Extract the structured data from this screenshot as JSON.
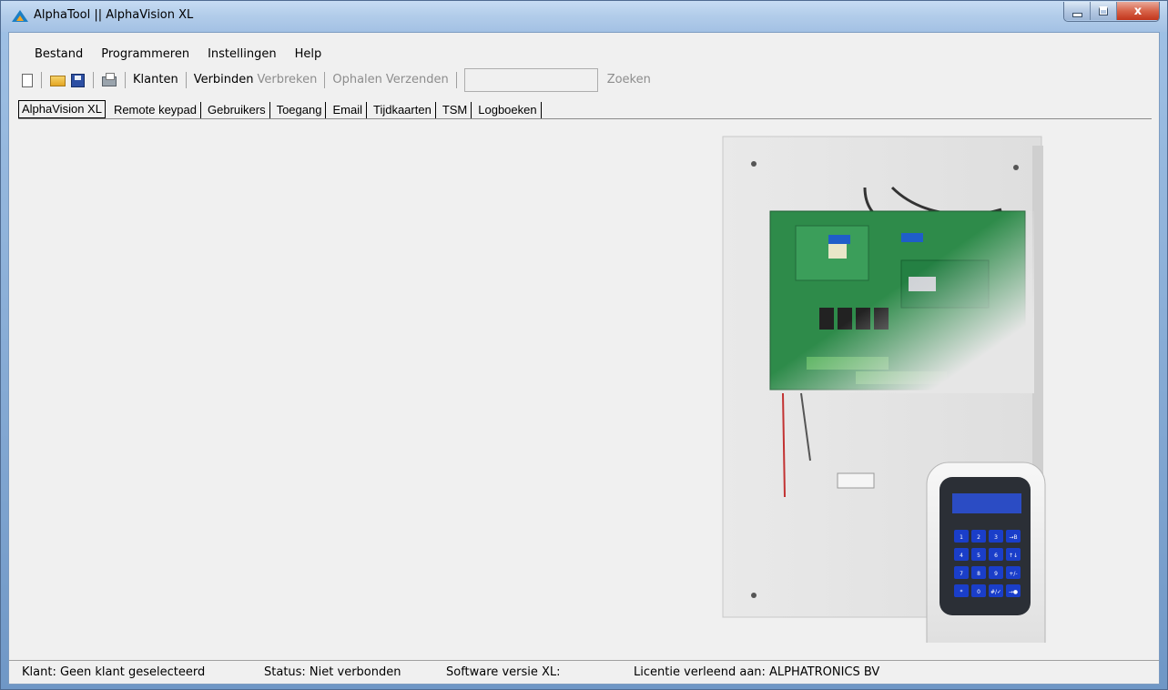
{
  "window": {
    "title": "AlphaTool || AlphaVision XL",
    "min_label": "",
    "max_label": "",
    "close_label": "x"
  },
  "menu": [
    "Bestand",
    "Programmeren",
    "Instellingen",
    "Help"
  ],
  "toolbar": {
    "klanten": "Klanten",
    "verbinden": "Verbinden",
    "verbreken": "Verbreken",
    "ophalen": "Ophalen",
    "verzenden": "Verzenden",
    "search_value": "",
    "zoeken": "Zoeken"
  },
  "tabs": [
    "AlphaVision XL",
    "Remote keypad",
    "Gebruikers",
    "Toegang",
    "Email",
    "Tijdkaarten",
    "TSM",
    "Logboeken"
  ],
  "status": {
    "klant": "Klant:   Geen klant geselecteerd",
    "status": "Status:  Niet verbonden",
    "software": "Software versie XL:",
    "licentie": "Licentie verleend aan:  ALPHATRONICS BV"
  },
  "keypad_keys": [
    "1",
    "2",
    "3",
    "→B",
    "4",
    "5",
    "6",
    "↑↓",
    "7",
    "8",
    "9",
    "+/-",
    "*",
    "0",
    "#/✓",
    "→●"
  ],
  "colors": {
    "titlebar": "#b3cdea",
    "client": "#f0f0f0",
    "accent_blue": "#2d4fa3",
    "lcd": "#2b4cc4",
    "keys": "#1a3ec9"
  }
}
